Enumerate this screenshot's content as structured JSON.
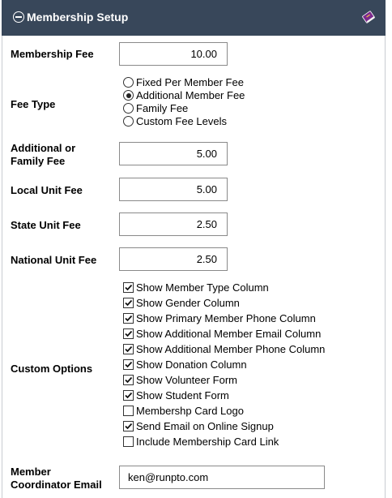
{
  "header": {
    "title": "Membership Setup",
    "collapse_icon": "minus-circle-icon",
    "help_icon": "help-book-icon"
  },
  "fields": {
    "membership_fee": {
      "label": "Membership Fee",
      "value": "10.00"
    },
    "additional_fee": {
      "label1": "Additional or",
      "label2": "Family Fee",
      "value": "5.00"
    },
    "local_fee": {
      "label": "Local Unit Fee",
      "value": "5.00"
    },
    "state_fee": {
      "label": "State Unit Fee",
      "value": "2.50"
    },
    "national_fee": {
      "label": "National Unit Fee",
      "value": "2.50"
    },
    "coordinator_email": {
      "label1": "Member",
      "label2": "Coordinator Email",
      "value": "ken@runpto.com"
    }
  },
  "fee_type": {
    "label": "Fee Type",
    "options": [
      {
        "label": "Fixed Per Member Fee",
        "selected": false
      },
      {
        "label": "Additional Member Fee",
        "selected": true
      },
      {
        "label": "Family Fee",
        "selected": false
      },
      {
        "label": "Custom Fee Levels",
        "selected": false
      }
    ]
  },
  "custom_options": {
    "label": "Custom Options",
    "items": [
      {
        "label": "Show Member Type Column",
        "checked": true
      },
      {
        "label": "Show Gender Column",
        "checked": true
      },
      {
        "label": "Show Primary Member Phone Column",
        "checked": true
      },
      {
        "label": "Show Additional Member Email Column",
        "checked": true
      },
      {
        "label": "Show Additional Member Phone Column",
        "checked": true
      },
      {
        "label": "Show Donation Column",
        "checked": true
      },
      {
        "label": "Show Volunteer Form",
        "checked": true
      },
      {
        "label": "Show Student Form",
        "checked": true
      },
      {
        "label": "Membershp Card Logo",
        "checked": false
      },
      {
        "label": "Send Email on Online Signup",
        "checked": true
      },
      {
        "label": "Include Membership Card Link",
        "checked": false
      }
    ]
  }
}
